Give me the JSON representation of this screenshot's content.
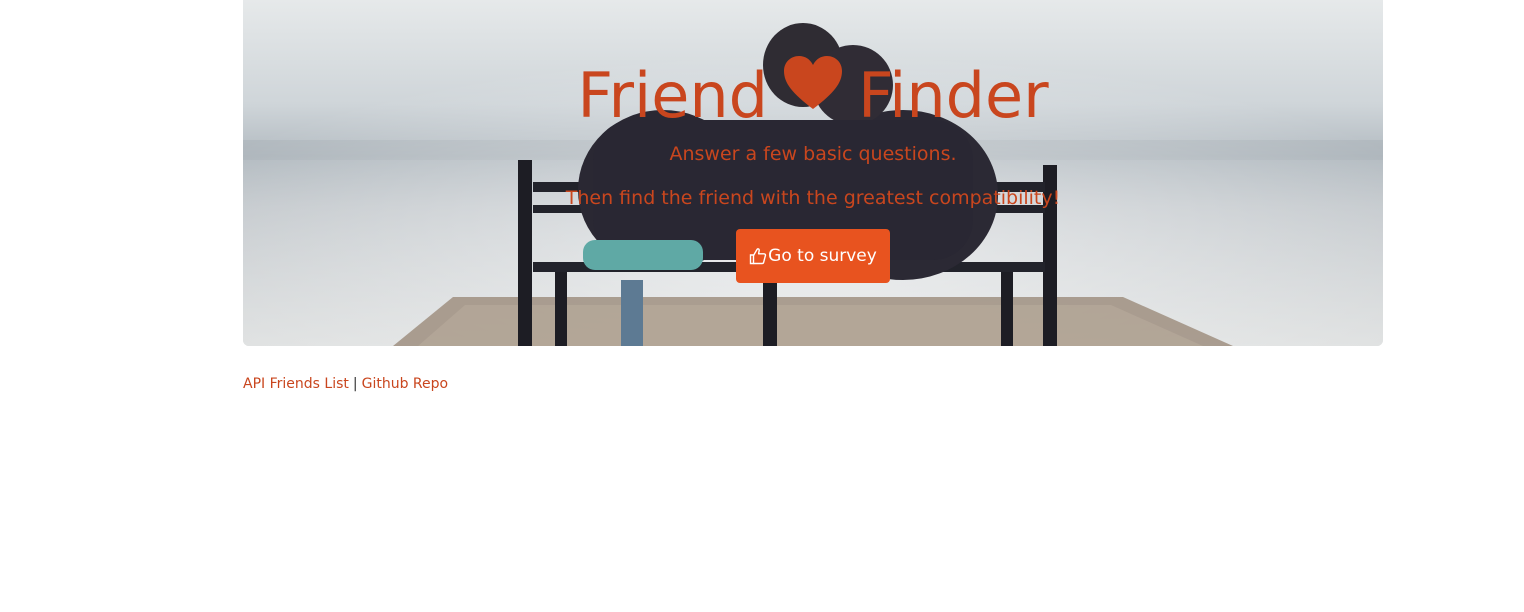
{
  "hero": {
    "title_left": "Friend",
    "title_right": "Finder",
    "title_icon": "heart-icon",
    "subtitle_1": "Answer a few basic questions.",
    "subtitle_2": "Then find the friend with the greatest compatibility!",
    "survey_button": {
      "label": "Go to survey",
      "icon": "thumbs-up-icon"
    }
  },
  "footer": {
    "links": [
      {
        "label": "API Friends List"
      },
      {
        "label": "Github Repo"
      }
    ],
    "separator": "|"
  },
  "colors": {
    "accent": "#c9461e",
    "button": "#e8531f",
    "button_text": "#ffffff"
  }
}
